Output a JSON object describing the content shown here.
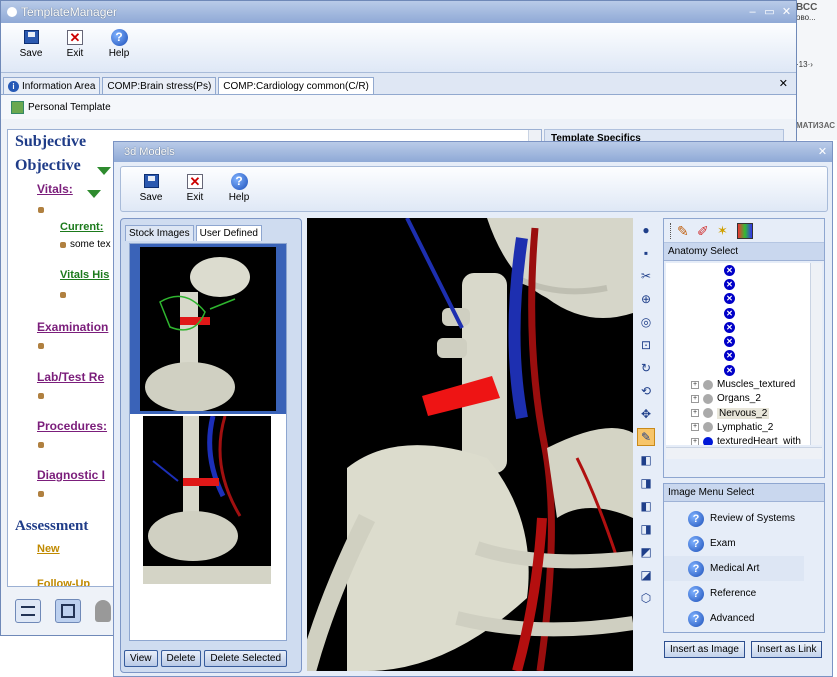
{
  "bg_strip": {
    "line1": "ВСС",
    "line2": "ово...",
    "line3": "·13·›",
    "line4": "МАТИЗАС"
  },
  "template_manager": {
    "title": "TemplateManager",
    "toolbar": {
      "save": "Save",
      "exit": "Exit",
      "help": "Help"
    },
    "tabs": [
      "Information Area",
      "COMP:Brain stress(Ps)",
      "COMP:Cardiology common(C/R)"
    ],
    "personal_template": "Personal Template",
    "right_header": "Template Specifics",
    "sections": {
      "subjective": "Subjective",
      "objective": "Objective",
      "assessment": "Assessment"
    },
    "subsections": {
      "vitals": "Vitals:",
      "current": "Current:",
      "current_text": "some tex",
      "vitals_history": "Vitals His",
      "examination": "Examination",
      "lab": "Lab/Test Re",
      "procedures": "Procedures:",
      "diagnostic": "Diagnostic I",
      "new": "New",
      "followup": "Follow-Up"
    }
  },
  "models3d": {
    "title": "3d Models",
    "toolbar": {
      "save": "Save",
      "exit": "Exit",
      "help": "Help"
    },
    "left_tabs": [
      "Stock Images",
      "User Defined"
    ],
    "buttons": {
      "view": "View",
      "delete": "Delete",
      "delete_selected": "Delete Selected"
    },
    "anatomy_header": "Anatomy Select",
    "tree_items": [
      "Muscles_textured",
      "Organs_2",
      "Nervous_2",
      "Lymphatic_2",
      "texturedHeart_with"
    ],
    "menu_header": "Image Menu Select",
    "menu_items": [
      "Review of Systems",
      "Exam",
      "Medical Art",
      "Reference",
      "Advanced"
    ],
    "insert_image": "Insert as Image",
    "insert_link": "Insert as Link"
  }
}
